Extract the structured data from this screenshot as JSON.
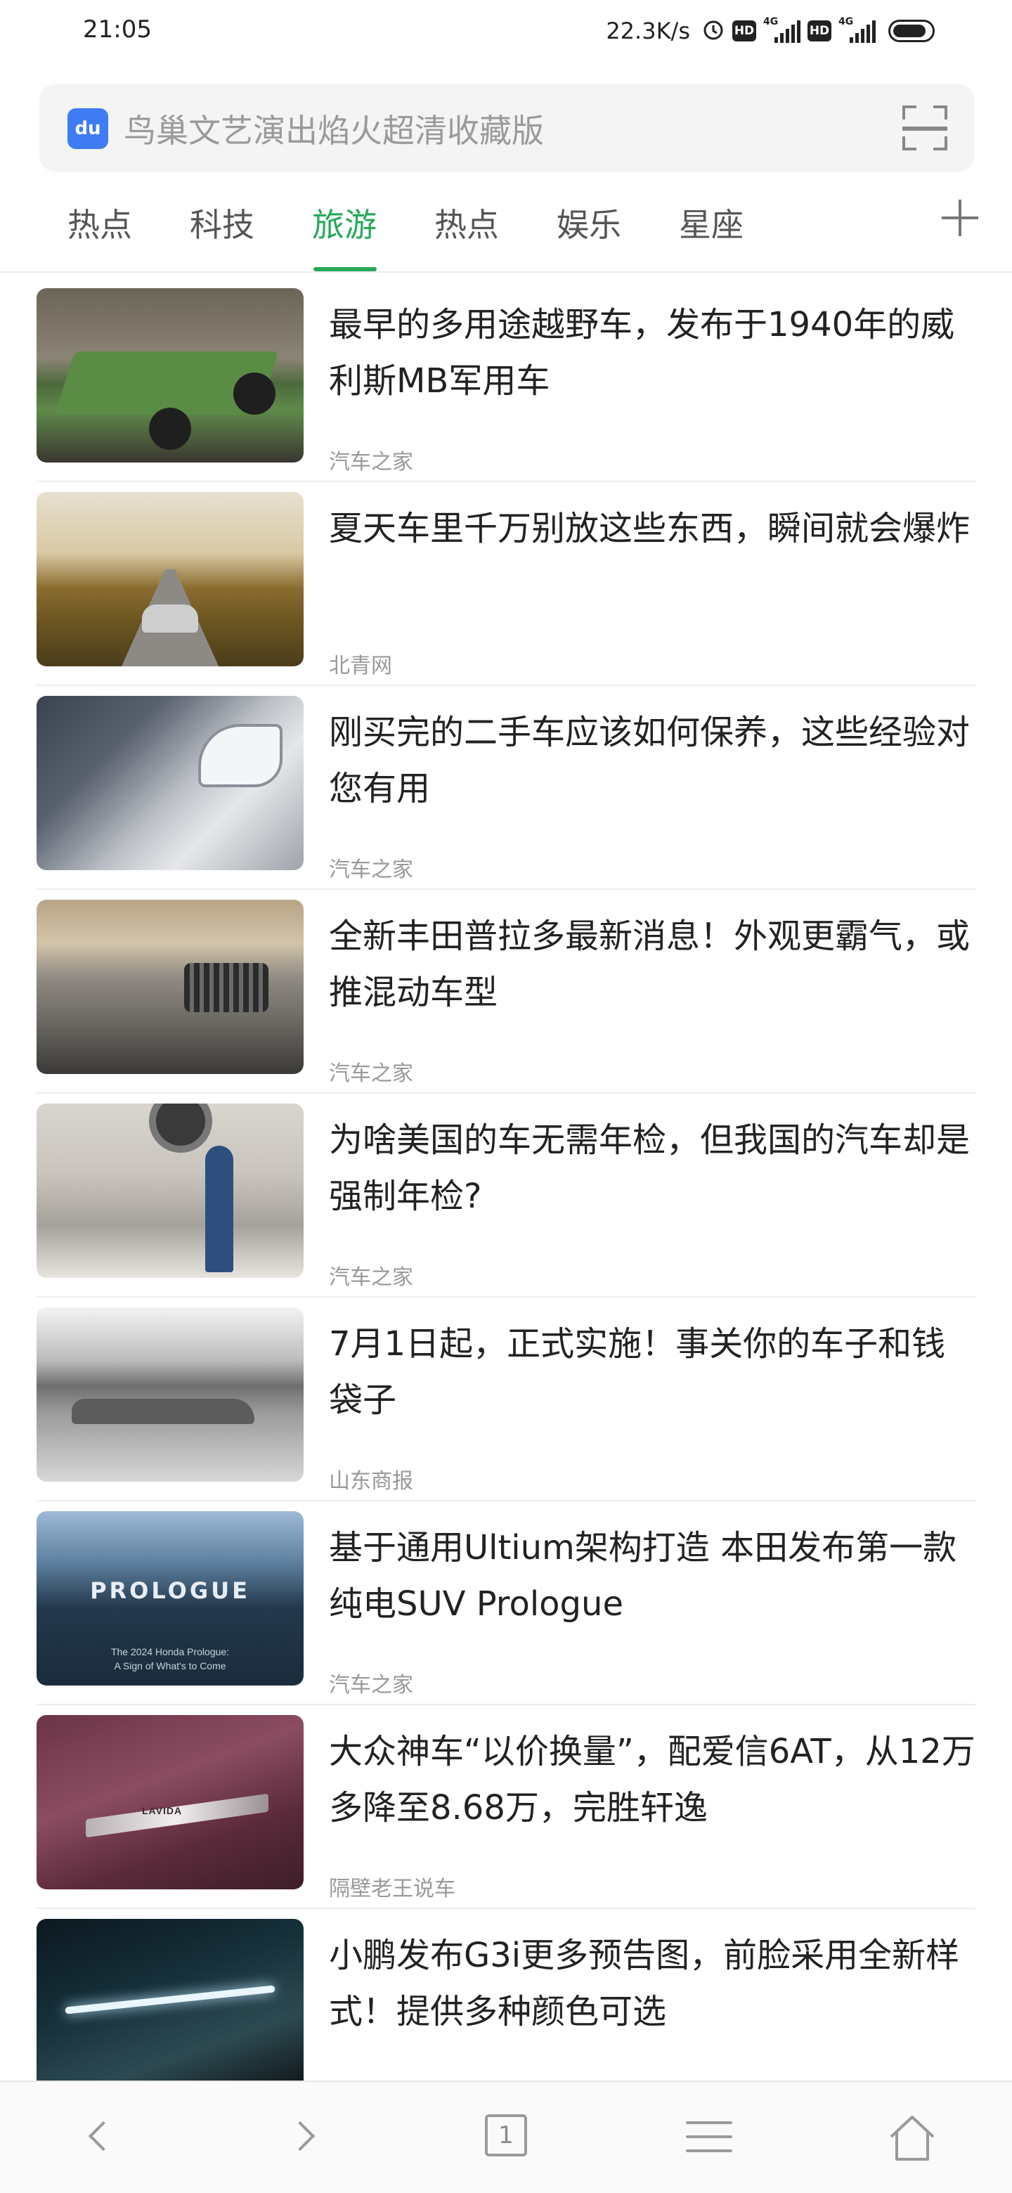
{
  "status_bar": {
    "time": "21:05",
    "net_speed": "22.3K/s",
    "hd1": "HD",
    "hd2": "HD",
    "sig1": "4G",
    "sig2": "4G"
  },
  "search": {
    "placeholder": "鸟巢文艺演出焰火超清收藏版",
    "logo_text": "du"
  },
  "tabs": [
    "热点",
    "科技",
    "旅游",
    "热点",
    "娱乐",
    "星座"
  ],
  "active_tab": "旅游",
  "feed": [
    {
      "title": "最早的多用途越野车，发布于1940年的威利斯MB军用车",
      "source": "汽车之家"
    },
    {
      "title": "夏天车里千万别放这些东西，瞬间就会爆炸",
      "source": "北青网"
    },
    {
      "title": "刚买完的二手车应该如何保养，这些经验对您有用",
      "source": "汽车之家"
    },
    {
      "title": "全新丰田普拉多最新消息！外观更霸气，或推混动车型",
      "source": "汽车之家"
    },
    {
      "title": "为啥美国的车无需年检，但我国的汽车却是强制年检?",
      "source": "汽车之家"
    },
    {
      "title": "7月1日起，正式实施！事关你的车子和钱袋子",
      "source": "山东商报"
    },
    {
      "title": "基于通用Ultium架构打造 本田发布第一款纯电SUV Prologue",
      "source": "汽车之家",
      "thumb_word": "PROLOGUE",
      "thumb_caption1": "The 2024 Honda Prologue:",
      "thumb_caption2": "A Sign of What's to Come"
    },
    {
      "title": "大众神车“以价换量”，配爱信6AT，从12万多降至8.68万，完胜轩逸",
      "source": "隔壁老王说车",
      "thumb_badge": "LAVIDA"
    },
    {
      "title": "小鹏发布G3i更多预告图，前脸采用全新样式！提供多种颜色可选",
      "source": ""
    }
  ],
  "bottom_nav": {
    "tab_count": "1"
  },
  "colors": {
    "accent": "#27a85a",
    "text": "#222222",
    "muted": "#999999"
  }
}
